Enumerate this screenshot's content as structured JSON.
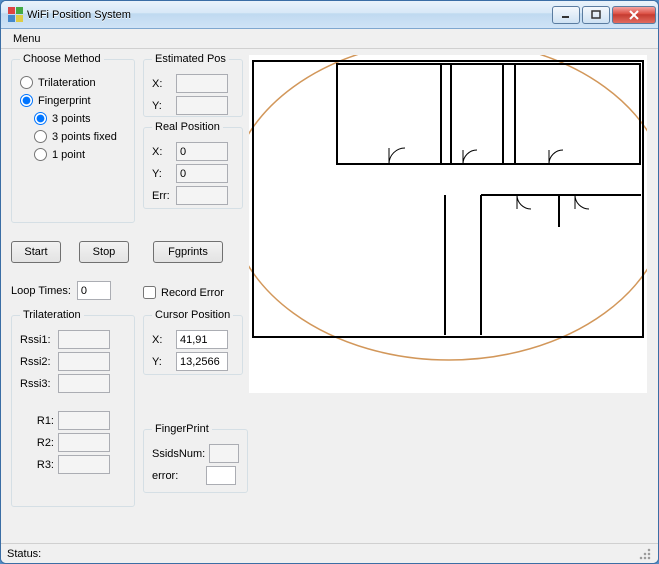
{
  "window": {
    "title": "WiFi Position System"
  },
  "menu": {
    "label": "Menu"
  },
  "chooseMethod": {
    "legend": "Choose Method",
    "trilateration": "Trilateration",
    "fingerprint": "Fingerprint",
    "points3": "3 points",
    "points3fixed": "3 points fixed",
    "point1": "1 point"
  },
  "estimatedPos": {
    "legend": "Estimated Pos",
    "xLabel": "X:",
    "xValue": "",
    "yLabel": "Y:",
    "yValue": ""
  },
  "realPos": {
    "legend": "Real Position",
    "xLabel": "X:",
    "xValue": "0",
    "yLabel": "Y:",
    "yValue": "0",
    "errLabel": "Err:",
    "errValue": ""
  },
  "buttons": {
    "start": "Start",
    "stop": "Stop",
    "fgprints": "Fgprints"
  },
  "loop": {
    "label": "Loop Times:",
    "value": "0"
  },
  "recordError": {
    "label": "Record Error"
  },
  "trilateration": {
    "legend": "Trilateration",
    "rssi1": "Rssi1:",
    "rssi1v": "",
    "rssi2": "Rssi2:",
    "rssi2v": "",
    "rssi3": "Rssi3:",
    "rssi3v": "",
    "r1": "R1:",
    "r1v": "",
    "r2": "R2:",
    "r2v": "",
    "r3": "R3:",
    "r3v": ""
  },
  "cursorPos": {
    "legend": "Cursor Position",
    "xLabel": "X:",
    "xValue": "41,91",
    "yLabel": "Y:",
    "yValue": "13,2566"
  },
  "fingerprint": {
    "legend": "FingerPrint",
    "ssidsNum": "SsidsNum:",
    "ssidsNumV": "",
    "error": "error:",
    "errorV": ""
  },
  "status": {
    "label": "Status:"
  }
}
